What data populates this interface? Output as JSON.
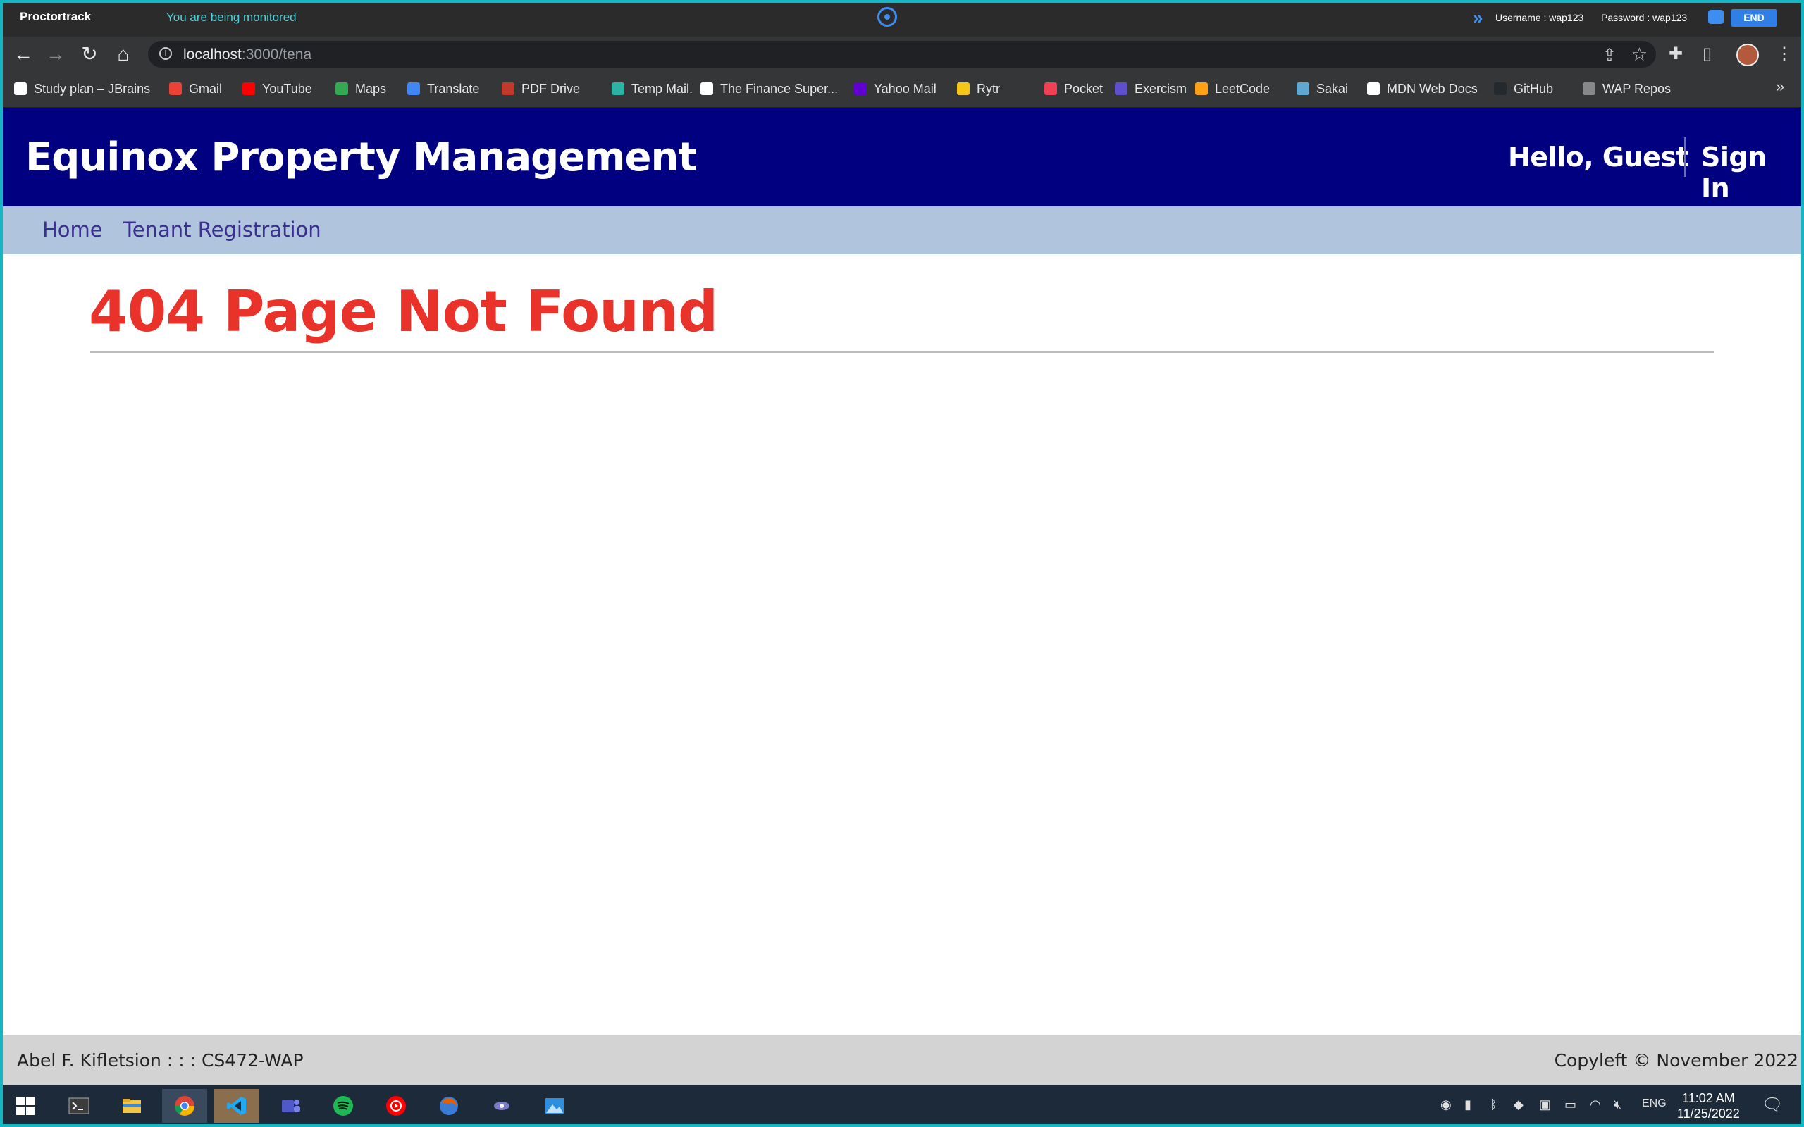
{
  "proctor": {
    "brand": "Proctortrack",
    "monitor_text": "You are being monitored",
    "username": "Username : wap123",
    "password": "Password : wap123",
    "end_label": "END"
  },
  "browser": {
    "url_host": "localhost",
    "url_path": ":3000/tena",
    "bookmarks": [
      {
        "label": "Study plan – JBrains",
        "color": "#ffffff"
      },
      {
        "label": "Gmail",
        "color": "#ea4335"
      },
      {
        "label": "YouTube",
        "color": "#ff0000"
      },
      {
        "label": "Maps",
        "color": "#34a853"
      },
      {
        "label": "Translate",
        "color": "#4285f4"
      },
      {
        "label": "PDF Drive",
        "color": "#c0392b"
      },
      {
        "label": "Temp Mail.",
        "color": "#2bb3a3"
      },
      {
        "label": "The Finance Super...",
        "color": "#ffffff"
      },
      {
        "label": "Yahoo Mail",
        "color": "#6001d2"
      },
      {
        "label": "Rytr",
        "color": "#f5c518"
      },
      {
        "label": "Pocket",
        "color": "#ef4056"
      },
      {
        "label": "Exercism",
        "color": "#604fcd"
      },
      {
        "label": "LeetCode",
        "color": "#ffa116"
      },
      {
        "label": "Sakai",
        "color": "#5fa8d3"
      },
      {
        "label": "MDN Web Docs",
        "color": "#ffffff"
      },
      {
        "label": "GitHub",
        "color": "#24292e"
      },
      {
        "label": "WAP Repos",
        "color": "#888888"
      }
    ],
    "more": "»"
  },
  "app": {
    "title": "Equinox Property Management",
    "greeting": "Hello, Guest",
    "sign_in": "Sign In",
    "nav": {
      "home": "Home",
      "tenant_registration": "Tenant Registration"
    },
    "error_title": "404 Page Not Found",
    "footer_left": "Abel F. Kifletsion : : : CS472-WAP",
    "footer_right": "Copyleft © November 2022"
  },
  "taskbar": {
    "language": "ENG",
    "time": "11:02 AM",
    "date": "11/25/2022"
  },
  "colors": {
    "header_bg": "#000080",
    "nav_bg": "#b0c4de",
    "error_red": "#e8322a",
    "footer_bg": "#d3d3d3"
  }
}
